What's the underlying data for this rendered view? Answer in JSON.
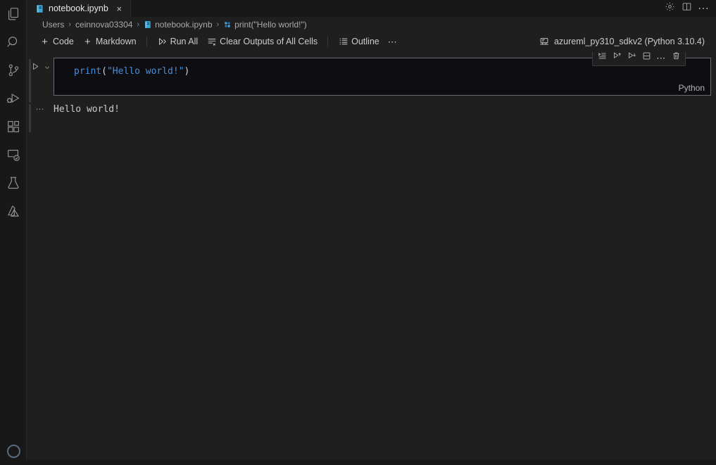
{
  "activitybar": {
    "items": [
      {
        "name": "explorer",
        "icon": "files-icon"
      },
      {
        "name": "search",
        "icon": "search-icon"
      },
      {
        "name": "source-control",
        "icon": "source-control-icon"
      },
      {
        "name": "run-and-debug",
        "icon": "run-debug-icon"
      },
      {
        "name": "extensions",
        "icon": "extensions-icon"
      },
      {
        "name": "remote-explorer",
        "icon": "remote-explorer-icon"
      },
      {
        "name": "testing",
        "icon": "beaker-icon"
      },
      {
        "name": "azure",
        "icon": "azure-icon"
      }
    ],
    "bottom": {
      "name": "accounts",
      "icon": "account-circle-icon"
    }
  },
  "tabs": [
    {
      "label": "notebook.ipynb",
      "icon": "notebook-icon",
      "active": true,
      "close": "×"
    }
  ],
  "titlebar_actions": [
    {
      "label": "",
      "icon": "gear-icon"
    },
    {
      "label": "",
      "icon": "split-editor-icon"
    },
    {
      "label": "⋯",
      "icon": "more-actions-icon"
    }
  ],
  "breadcrumb": {
    "separator": "›",
    "items": [
      {
        "label": "Users",
        "icon": null
      },
      {
        "label": "ceinnova03304",
        "icon": null
      },
      {
        "label": "notebook.ipynb",
        "icon": "notebook-icon"
      },
      {
        "label": "print(\"Hello world!\")",
        "icon": "python-symbol-icon"
      }
    ]
  },
  "notebook_toolbar": {
    "add_code": {
      "label": "Code",
      "icon": "plus-icon"
    },
    "add_markdown": {
      "label": "Markdown",
      "icon": "plus-icon"
    },
    "run_all": {
      "label": "Run All",
      "icon": "run-all-icon"
    },
    "clear_outputs": {
      "label": "Clear Outputs of All Cells",
      "icon": "clear-all-icon"
    },
    "outline": {
      "label": "Outline",
      "icon": "outline-icon"
    },
    "overflow": {
      "label": "⋯",
      "icon": "more-actions-icon"
    },
    "kernel": {
      "label": "azureml_py310_sdkv2 (Python 3.10.4)",
      "icon": "kernel-icon"
    }
  },
  "cell": {
    "run_button": {
      "icon": "play-icon"
    },
    "chevron": {
      "icon": "chevron-down-icon"
    },
    "language": "Python",
    "code": {
      "function": "print",
      "open_paren": "(",
      "string": "\"Hello world!\"",
      "close_paren": ")"
    },
    "toolbar": [
      {
        "name": "run-by-line",
        "icon": "run-by-line-icon"
      },
      {
        "name": "run-above",
        "icon": "run-above-icon"
      },
      {
        "name": "run-below",
        "icon": "run-below-icon"
      },
      {
        "name": "split-cell",
        "icon": "split-cell-icon"
      },
      {
        "name": "more-actions",
        "icon": "more-actions-icon",
        "label": "⋯"
      },
      {
        "name": "delete-cell",
        "icon": "trash-icon"
      }
    ],
    "output": {
      "collapse_indicator": "⋯",
      "text": "Hello world!"
    }
  },
  "colors": {
    "activitybar_bg": "#181818",
    "editor_bg": "#1f1f1f",
    "cell_bg": "#0d0d12",
    "cell_border_focus": "#6a6a75",
    "accent_blue": "#4a8fd6",
    "notebook_icon_blue": "#3ba5d8",
    "text": "#cccccc"
  }
}
